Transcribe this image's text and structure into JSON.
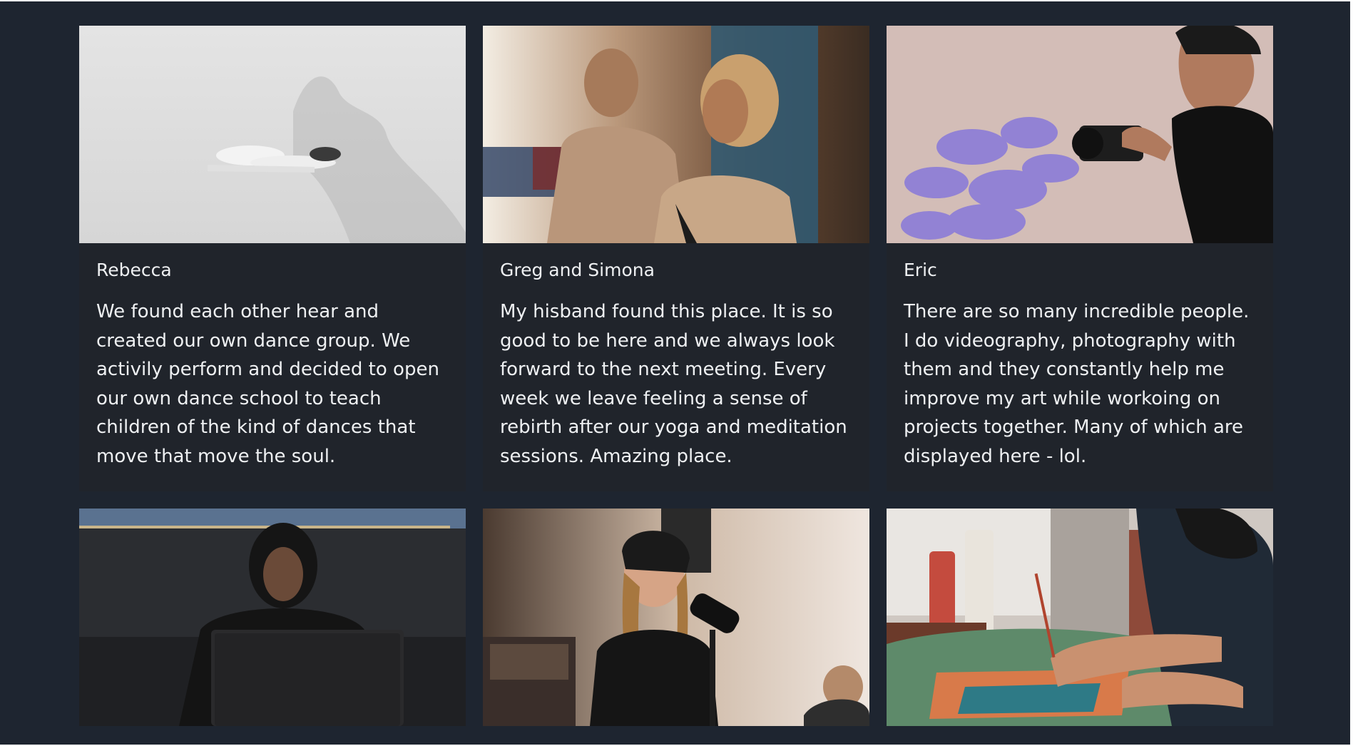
{
  "testimonials": [
    {
      "name": "Rebecca",
      "text": "We found each other hear and created our own dance group. We activily perform and decided to open our own dance school to teach children of the kind of dances that move that move the soul.",
      "photo_icon": "dancer-photo"
    },
    {
      "name": "Greg and Simona",
      "text": "My hisband found this place. It is so good to be here and we always look forward to the next meeting. Every week we leave feeling a sense of rebirth after our yoga and meditation sessions. Amazing place.",
      "photo_icon": "couple-meditating-photo"
    },
    {
      "name": "Eric",
      "text": "There are so many incredible people. I do videography, photography with them and they constantly help me improve my art while workoing on projects together. Many of which are displayed here - lol.",
      "photo_icon": "photographer-photo"
    },
    {
      "photo_icon": "laptop-hoodie-photo"
    },
    {
      "photo_icon": "singer-microphone-photo"
    },
    {
      "photo_icon": "painter-photo"
    }
  ],
  "colors": {
    "page_background": "#1e2530",
    "card_background": "#20242b",
    "text": "#eef0f2"
  }
}
